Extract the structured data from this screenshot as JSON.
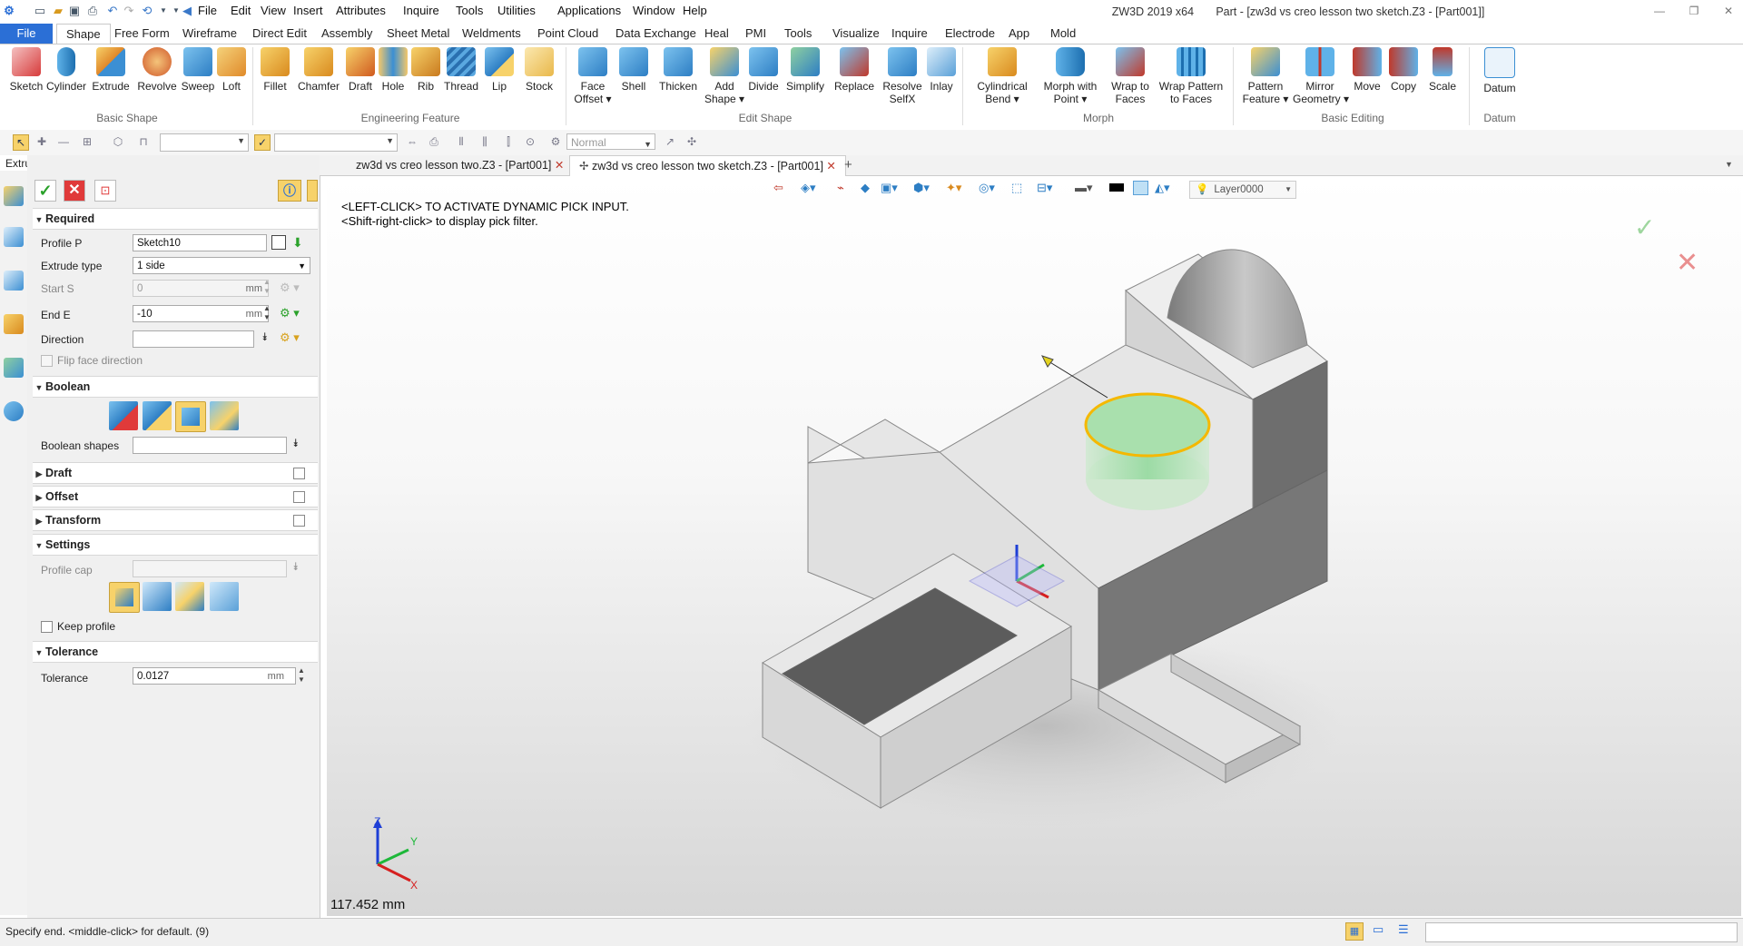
{
  "app": {
    "title": "ZW3D 2019  x64",
    "document_title": "Part - [zw3d vs creo lesson two sketch.Z3 - [Part001]]"
  },
  "menu": [
    "File",
    "Edit",
    "View",
    "Insert",
    "Attributes",
    "Inquire",
    "Tools",
    "Utilities",
    "Applications",
    "Window",
    "Help"
  ],
  "ribbon_tabs": [
    "File",
    "Shape",
    "Free Form",
    "Wireframe",
    "Direct Edit",
    "Assembly",
    "Sheet Metal",
    "Weldments",
    "Point Cloud",
    "Data Exchange",
    "Heal",
    "PMI",
    "Tools",
    "Visualize",
    "Inquire",
    "Electrode",
    "App",
    "Mold"
  ],
  "ribbon_groups": {
    "basic_shape": {
      "label": "Basic Shape",
      "tools": [
        "Sketch",
        "Cylinder",
        "Extrude",
        "Revolve",
        "Sweep",
        "Loft"
      ]
    },
    "engineering_feature": {
      "label": "Engineering Feature",
      "tools": [
        "Fillet",
        "Chamfer",
        "Draft",
        "Hole",
        "Rib",
        "Thread",
        "Lip",
        "Stock"
      ]
    },
    "edit_shape": {
      "label": "Edit Shape",
      "tools": [
        "Face Offset",
        "Shell",
        "Thicken",
        "Add Shape",
        "Divide",
        "Simplify",
        "Replace",
        "Resolve SelfX",
        "Inlay"
      ]
    },
    "morph": {
      "label": "Morph",
      "tools": [
        "Cylindrical Bend",
        "Morph with Point",
        "Wrap to Faces",
        "Wrap Pattern to Faces"
      ]
    },
    "basic_editing": {
      "label": "Basic Editing",
      "tools": [
        "Pattern Feature",
        "Mirror Geometry",
        "Move",
        "Copy",
        "Scale"
      ]
    },
    "datum": {
      "label": "Datum",
      "tools": [
        "Datum"
      ]
    }
  },
  "toolbar2": {
    "render_mode": "Normal"
  },
  "panel": {
    "title": "Extrude",
    "required": {
      "label": "Required",
      "profile_label": "Profile P",
      "profile_value": "Sketch10",
      "extrude_type_label": "Extrude type",
      "extrude_type_value": "1 side",
      "start_label": "Start S",
      "start_value": "0",
      "end_label": "End E",
      "end_value": "-10",
      "unit": "mm",
      "direction_label": "Direction",
      "flip_label": "Flip face direction"
    },
    "boolean": {
      "label": "Boolean",
      "shapes_label": "Boolean shapes"
    },
    "draft": {
      "label": "Draft"
    },
    "offset": {
      "label": "Offset"
    },
    "transform": {
      "label": "Transform"
    },
    "settings": {
      "label": "Settings",
      "profile_cap_label": "Profile cap",
      "keep_profile_label": "Keep profile"
    },
    "tolerance": {
      "label": "Tolerance",
      "field_label": "Tolerance",
      "value": "0.0127",
      "unit": "mm"
    }
  },
  "doc_tabs": [
    {
      "label": "zw3d vs creo lesson two.Z3 - [Part001]"
    },
    {
      "label": "zw3d vs creo lesson two sketch.Z3 - [Part001]"
    }
  ],
  "viewport": {
    "hint_line1": "<LEFT-CLICK> TO ACTIVATE DYNAMIC PICK INPUT.",
    "hint_line2": "<Shift-right-click> to display pick filter.",
    "measurement": "117.452 mm",
    "layer": "Layer0000",
    "axis_z": "Z",
    "axis_y": "Y",
    "axis_x": "X"
  },
  "status": {
    "text": "Specify end.   <middle-click> for default. (9)"
  },
  "colors": {
    "accent_blue": "#2b6fd6",
    "selection_yellow": "#f5b800",
    "preview_green": "#7fd67f",
    "cancel_red": "#e03a3a",
    "ok_green": "#2aa12a"
  }
}
